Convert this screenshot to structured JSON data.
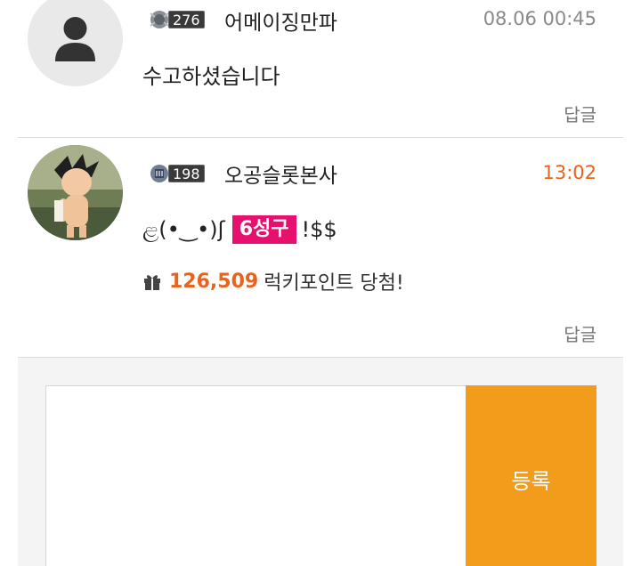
{
  "comments": [
    {
      "level": "276",
      "nickname": "어메이징만파",
      "date": "08.06 00:45",
      "text": "수고하셨습니다",
      "reply": "답글"
    },
    {
      "level": "198",
      "nickname": "오공슬롯본사",
      "date": "13:02",
      "text_prefix": "ළ(•‿•)ʃ",
      "tag": "6성구",
      "text_suffix": "!$$",
      "lucky_points": "126,509",
      "lucky_text": "럭키포인트 당첨!",
      "reply": "답글"
    }
  ],
  "form": {
    "submit_label": "등록"
  },
  "colors": {
    "accent_orange": "#e8641e",
    "button_orange": "#f39b1a",
    "tag_pink": "#e6106f"
  }
}
